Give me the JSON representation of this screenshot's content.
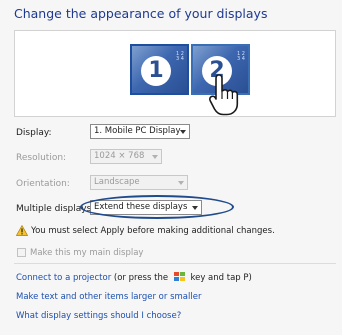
{
  "header": {
    "title": "Change the appearance of your displays"
  },
  "monitors": [
    {
      "number": "1",
      "side_label": "1 2 3 4"
    },
    {
      "number": "2",
      "side_label": "1 2 3 4"
    }
  ],
  "settings": {
    "display": {
      "label": "Display:",
      "value": "1. Mobile PC Display"
    },
    "resolution": {
      "label": "Resolution:",
      "value": "1024 × 768"
    },
    "orientation": {
      "label": "Orientation:",
      "value": "Landscape"
    },
    "multiple_displays": {
      "label": "Multiple displays:",
      "value": "Extend these displays"
    }
  },
  "warning": {
    "text": "You must select Apply before making additional changes."
  },
  "main_display": {
    "label": "Make this my main display"
  },
  "links": {
    "projector_link": "Connect to a projector",
    "projector_rest_1": "(or press the",
    "projector_rest_2": "key and tap P)",
    "text_size": "Make text and other items larger or smaller",
    "display_settings_help": "What display settings should I choose?"
  },
  "colors": {
    "title": "#1e3a8f",
    "link": "#1c4fb0",
    "monitor_accent": "#2a4f93",
    "annotation_ellipse": "#1f4a8c"
  }
}
